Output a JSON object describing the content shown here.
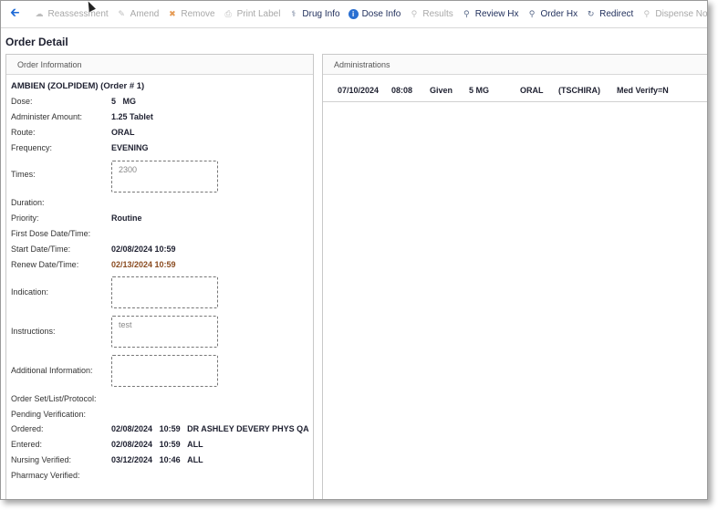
{
  "toolbar": {
    "reassessment": "Reassessment",
    "amend": "Amend",
    "remove": "Remove",
    "print_label": "Print Label",
    "drug_info": "Drug Info",
    "dose_info": "Dose Info",
    "results": "Results",
    "review_hx": "Review Hx",
    "order_hx": "Order Hx",
    "redirect": "Redirect",
    "dispense_notes": "Dispense Notes"
  },
  "page_title": "Order Detail",
  "order_info": {
    "header": "Order Information",
    "drug": "AMBIEN (ZOLPIDEM) (Order # 1)",
    "labels": {
      "dose": "Dose:",
      "administer_amount": "Administer Amount:",
      "route": "Route:",
      "frequency": "Frequency:",
      "times": "Times:",
      "duration": "Duration:",
      "priority": "Priority:",
      "first_dose": "First Dose Date/Time:",
      "start": "Start Date/Time:",
      "renew": "Renew Date/Time:",
      "indication": "Indication:",
      "instructions": "Instructions:",
      "additional_info": "Additional Information:",
      "order_set": "Order Set/List/Protocol:",
      "pending_verification": "Pending Verification:",
      "ordered": "Ordered:",
      "entered": "Entered:",
      "nursing_verified": "Nursing Verified:",
      "pharmacy_verified": "Pharmacy Verified:"
    },
    "values": {
      "dose_amount": "5",
      "dose_unit": "MG",
      "administer_amount": "1.25 Tablet",
      "route": "ORAL",
      "frequency": "EVENING",
      "times": "2300",
      "priority": "Routine",
      "start": "02/08/2024 10:59",
      "renew": "02/13/2024 10:59",
      "indication": "",
      "instructions": "test",
      "additional_info": "",
      "ordered_date": "02/08/2024",
      "ordered_time": "10:59",
      "ordered_by": "DR ASHLEY DEVERY PHYS QA",
      "entered_date": "02/08/2024",
      "entered_time": "10:59",
      "entered_by": "ALL",
      "nursing_date": "03/12/2024",
      "nursing_time": "10:46",
      "nursing_by": "ALL"
    }
  },
  "administrations": {
    "header": "Administrations",
    "rows": [
      {
        "date": "07/10/2024",
        "time": "08:08",
        "status": "Given",
        "dose": "5 MG",
        "route": "ORAL",
        "user": "(TSCHIRA)",
        "note": "Med Verify=N"
      }
    ]
  }
}
